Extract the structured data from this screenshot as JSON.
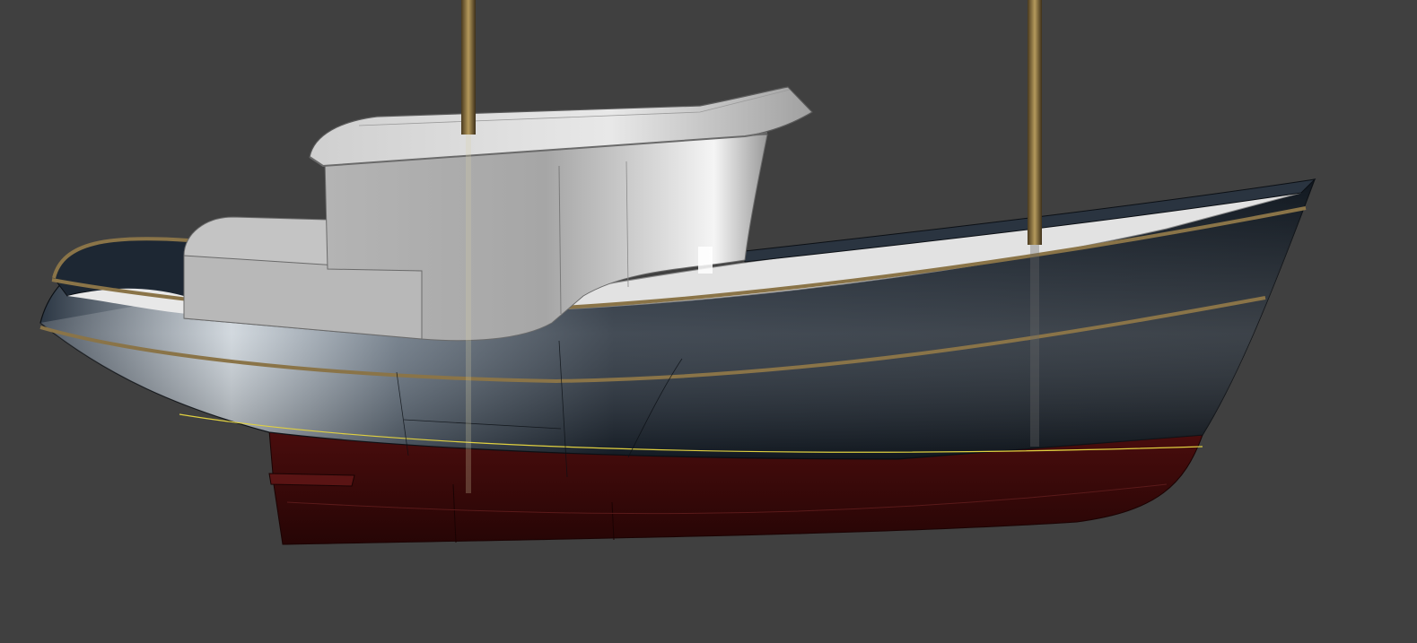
{
  "viewport": {
    "background_color": "#404040",
    "render_mode": "shaded-3d-model"
  },
  "model": {
    "subject": "tugboat-hull",
    "colors": {
      "topsides": "#1a2330",
      "topsides_highlight": "#b8c2cc",
      "bottom_paint": "#3a0a0a",
      "deck": "#e6e6e6",
      "cabin": "#c8c8c8",
      "rub_rail": "#8a7448",
      "mast": "#6a5530",
      "waterline": "#e0d040"
    },
    "masts": 2
  }
}
